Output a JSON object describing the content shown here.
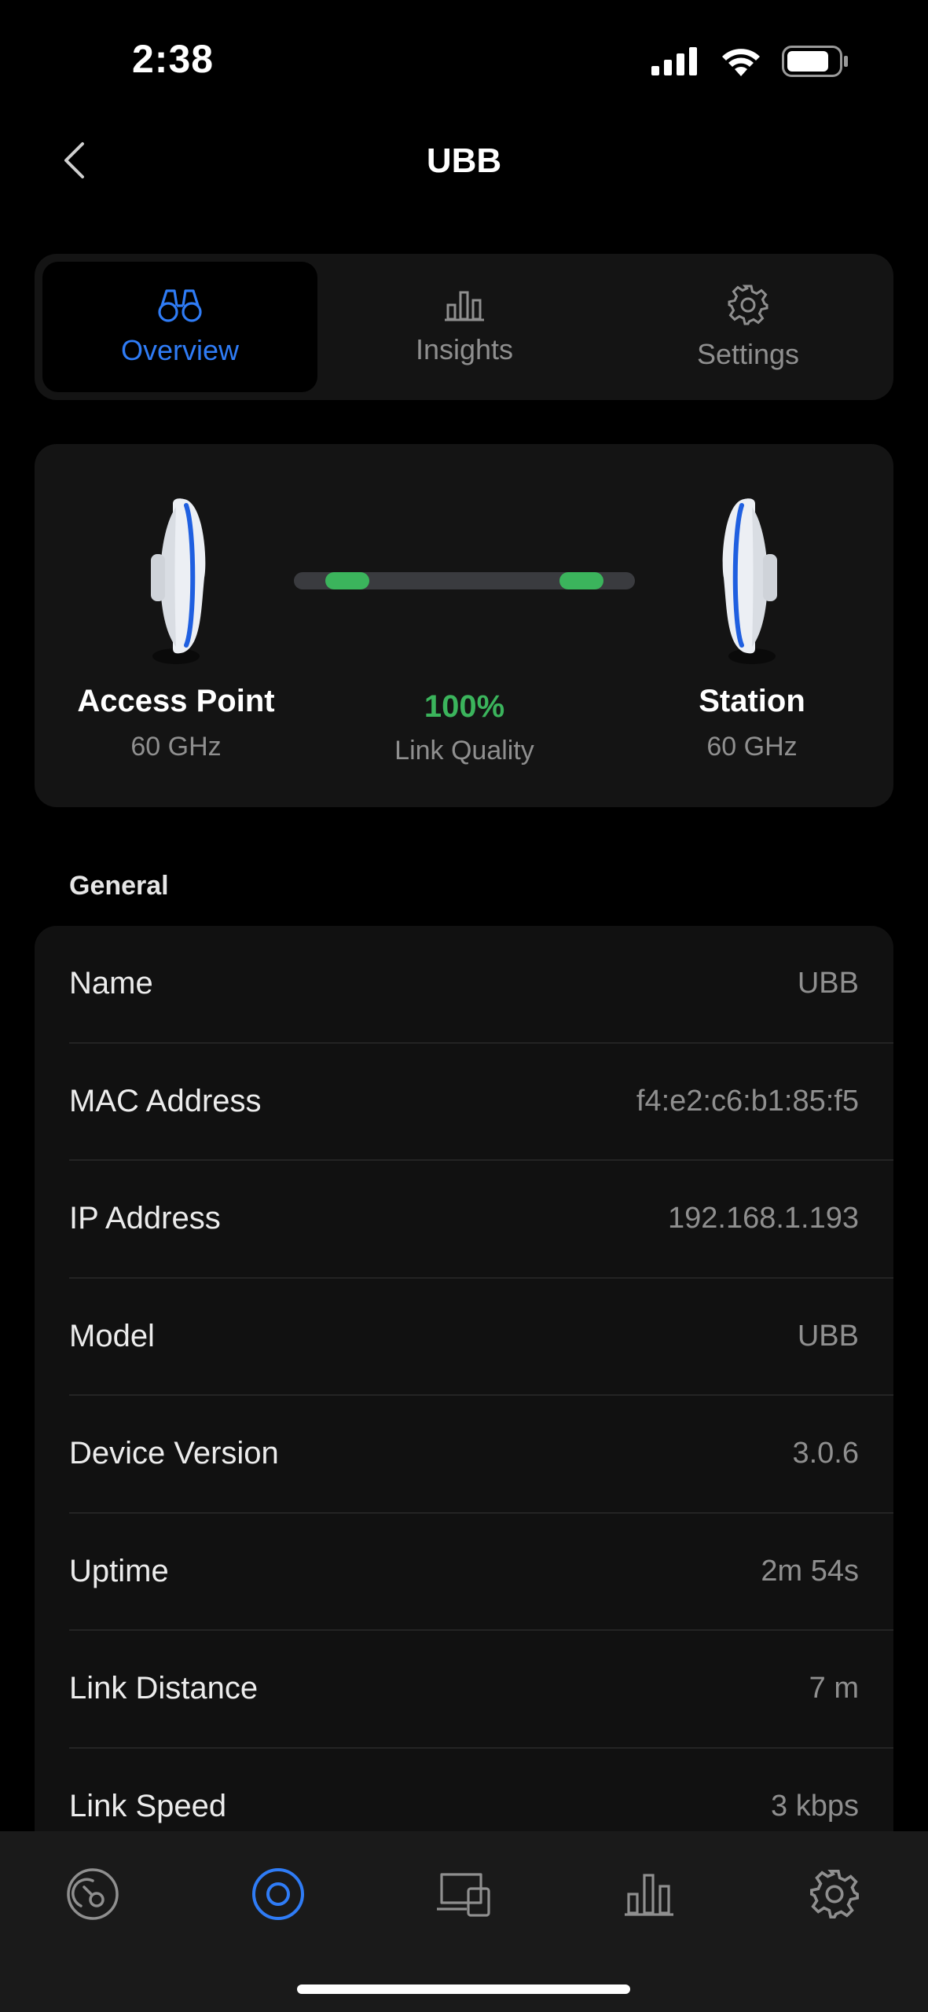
{
  "status_bar": {
    "time": "2:38"
  },
  "header": {
    "title": "UBB"
  },
  "tabs": [
    {
      "label": "Overview",
      "icon": "binoculars-icon",
      "active": true
    },
    {
      "label": "Insights",
      "icon": "bar-chart-icon",
      "active": false
    },
    {
      "label": "Settings",
      "icon": "gear-icon",
      "active": false
    }
  ],
  "link": {
    "left": {
      "title": "Access Point",
      "subtitle": "60 GHz"
    },
    "right": {
      "title": "Station",
      "subtitle": "60 GHz"
    },
    "quality_value": "100%",
    "quality_label": "Link Quality",
    "quality_color": "#3bb45c"
  },
  "general": {
    "title": "General",
    "rows": [
      {
        "label": "Name",
        "value": "UBB"
      },
      {
        "label": "MAC Address",
        "value": "f4:e2:c6:b1:85:f5"
      },
      {
        "label": "IP Address",
        "value": "192.168.1.193"
      },
      {
        "label": "Model",
        "value": "UBB"
      },
      {
        "label": "Device Version",
        "value": "3.0.6"
      },
      {
        "label": "Uptime",
        "value": "2m 54s"
      },
      {
        "label": "Link Distance",
        "value": "7 m"
      },
      {
        "label": "Link Speed",
        "value": "3 kbps"
      }
    ]
  },
  "bottom_nav": [
    {
      "icon": "dashboard-gauge-icon",
      "active": false
    },
    {
      "icon": "device-circle-icon",
      "active": true
    },
    {
      "icon": "devices-icon",
      "active": false
    },
    {
      "icon": "statistics-icon",
      "active": false
    },
    {
      "icon": "settings-gear-icon",
      "active": false
    }
  ],
  "colors": {
    "accent": "#2f7cf6",
    "background": "#000000",
    "card": "#141414",
    "muted": "#8f8f8f"
  }
}
